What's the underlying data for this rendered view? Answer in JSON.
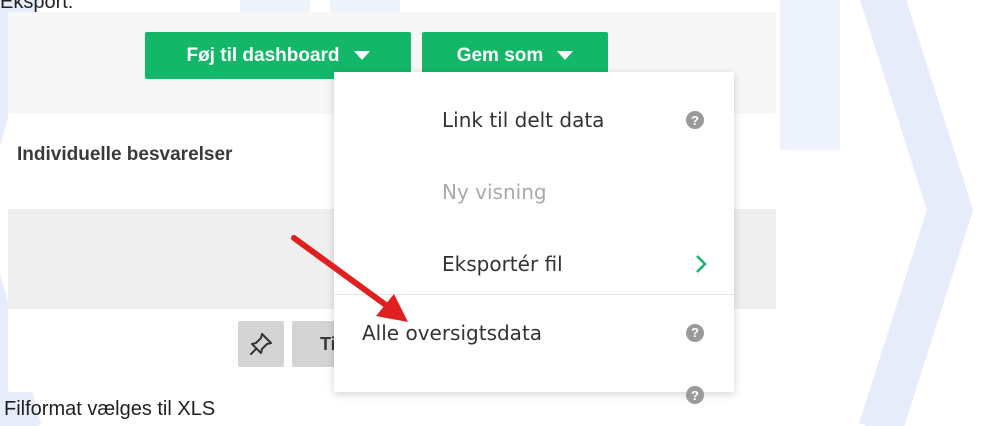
{
  "doc": {
    "heading": "Eksport:",
    "caption": "Filformat vælges til XLS"
  },
  "toolbar": {
    "add_dashboard_label": "Føj til dashboard",
    "save_as_label": "Gem som",
    "accent_color": "#12b768"
  },
  "content": {
    "section_label": "Individuelle besvarelser",
    "partial_button_label": "Ti"
  },
  "dropdown": {
    "items": [
      {
        "label": "Link til delt data",
        "icon": "help-icon",
        "enabled": true
      },
      {
        "label": "Ny visning",
        "enabled": false
      },
      {
        "label": "Eksportér fil",
        "icon": "chevron-right-icon",
        "enabled": true
      },
      {
        "label": "Alle oversigtsdata",
        "icon": "help-icon",
        "enabled": true
      }
    ]
  },
  "annotation": {
    "arrow_color": "#e02020"
  }
}
